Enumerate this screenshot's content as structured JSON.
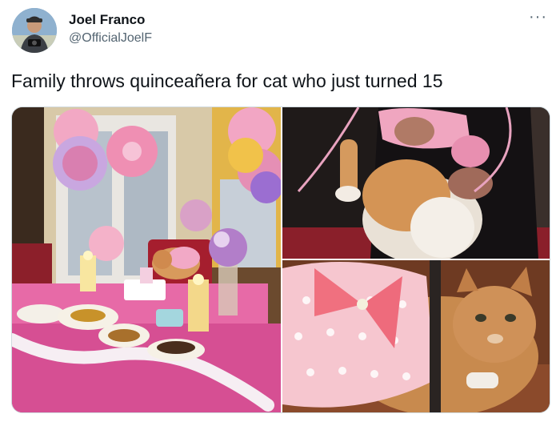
{
  "author": {
    "name": "Joel Franco",
    "handle": "@OfficialJoelF"
  },
  "tweet": {
    "text": "Family throws quinceañera for cat who just turned 15"
  },
  "more_menu": "···",
  "images": [
    {
      "name": "party-table-photo"
    },
    {
      "name": "cat-held-in-dress-photo"
    },
    {
      "name": "cat-in-pink-dress-photo"
    }
  ]
}
